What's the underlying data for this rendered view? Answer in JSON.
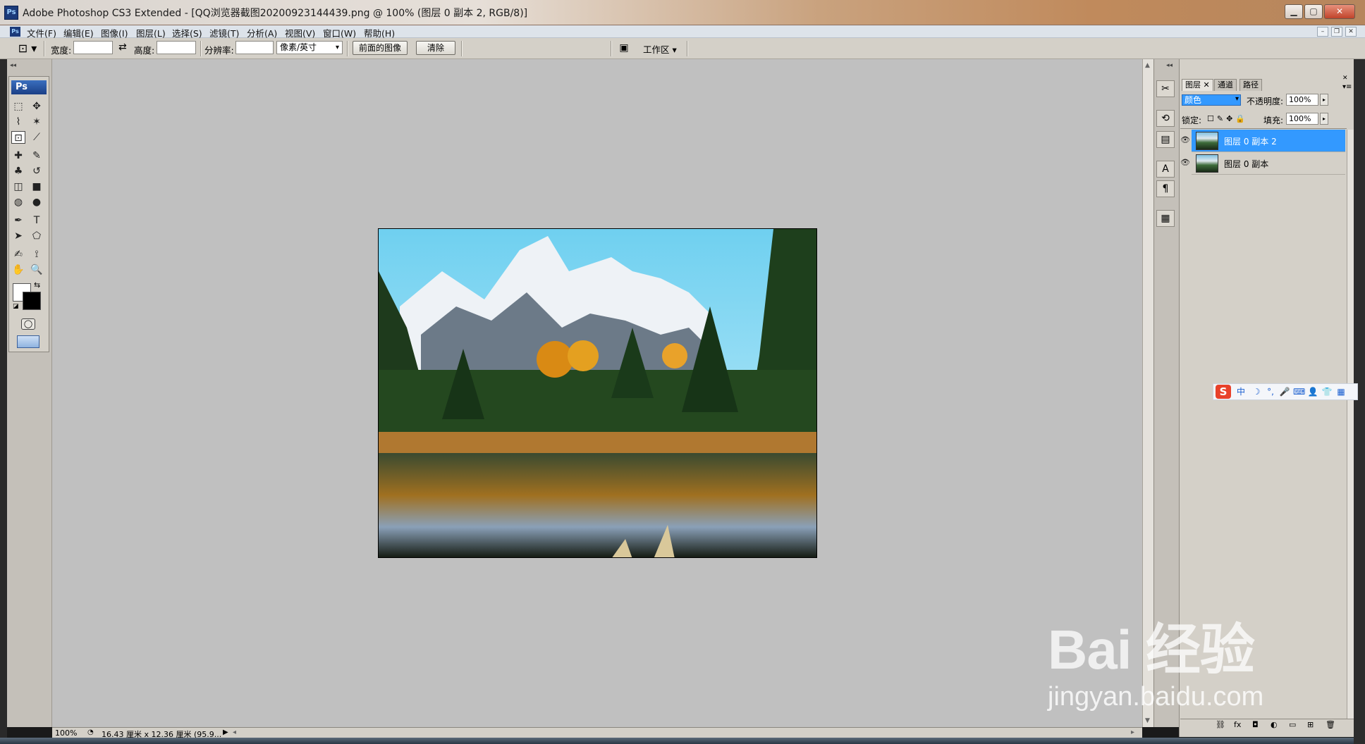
{
  "window": {
    "title": "Adobe Photoshop CS3 Extended - [QQ浏览器截图20200923144439.png @ 100% (图层 0 副本 2, RGB/8)]",
    "app_icon": "Ps",
    "minimize": "▁",
    "maximize": "▢",
    "close": "✕"
  },
  "menu": {
    "items": [
      "文件(F)",
      "编辑(E)",
      "图像(I)",
      "图层(L)",
      "选择(S)",
      "滤镜(T)",
      "分析(A)",
      "视图(V)",
      "窗口(W)",
      "帮助(H)"
    ],
    "mdi_minimize": "–",
    "mdi_restore": "❐",
    "mdi_close": "✕"
  },
  "options": {
    "width_label": "宽度:",
    "width_value": "",
    "swap_icon": "⇄",
    "height_label": "高度:",
    "height_value": "",
    "resolution_label": "分辨率:",
    "resolution_value": "",
    "unit_value": "像素/英寸",
    "front_image_button": "前面的图像",
    "clear_button": "清除",
    "workspace_label": "工作区 ▾"
  },
  "toolbox": {
    "badge": "Ps",
    "tools": [
      "marquee-icon",
      "move-icon",
      "lasso-icon",
      "magic-wand-icon",
      "crop-icon",
      "slice-icon",
      "healing-icon",
      "brush-icon",
      "clone-stamp-icon",
      "history-brush-icon",
      "eraser-icon",
      "gradient-icon",
      "blur-icon",
      "dodge-icon",
      "pen-icon",
      "type-icon",
      "path-select-icon",
      "shape-icon",
      "notes-icon",
      "eyedropper-icon",
      "hand-icon",
      "zoom-icon"
    ],
    "glyphs": [
      "⬚",
      "✥",
      "⌇",
      "✶",
      "⊡",
      "⟋",
      "✚",
      "✎",
      "♣",
      "↺",
      "◫",
      "■",
      "◍",
      "●",
      "✒",
      "T",
      "➤",
      "⬠",
      "✍",
      "⟟",
      "✋",
      "🔍"
    ]
  },
  "status": {
    "zoom": "100%",
    "doc_size": "16.43 厘米 x 12.36 厘米 (95.9..."
  },
  "layers_panel": {
    "tabs": [
      "图层",
      "通道",
      "路径"
    ],
    "blend_mode": "颜色",
    "opacity_label": "不透明度:",
    "opacity_value": "100%",
    "lock_label": "锁定:",
    "fill_label": "填充:",
    "fill_value": "100%",
    "layers": [
      {
        "name": "图层 0 副本 2",
        "selected": true
      },
      {
        "name": "图层 0 副本",
        "selected": false
      }
    ],
    "bottom_icons": [
      "link-icon",
      "fx-icon",
      "mask-icon",
      "adjustment-icon",
      "group-icon",
      "new-layer-icon",
      "trash-icon"
    ],
    "bottom_glyphs": [
      "⛓",
      "fx",
      "◘",
      "◐",
      "▭",
      "⊞",
      "🗑"
    ]
  },
  "ime": {
    "logo": "S",
    "lang": "中",
    "icons": [
      "☽",
      "°,",
      "🎤",
      "⌨",
      "👤",
      "👕",
      "▦"
    ]
  },
  "watermark": {
    "brand": "Bai 经验",
    "url": "jingyan.baidu.com"
  },
  "colors": {
    "selection_blue": "#3399ff",
    "canvas_bg": "#c0c0c0",
    "panel_bg": "#d4d0c8"
  }
}
